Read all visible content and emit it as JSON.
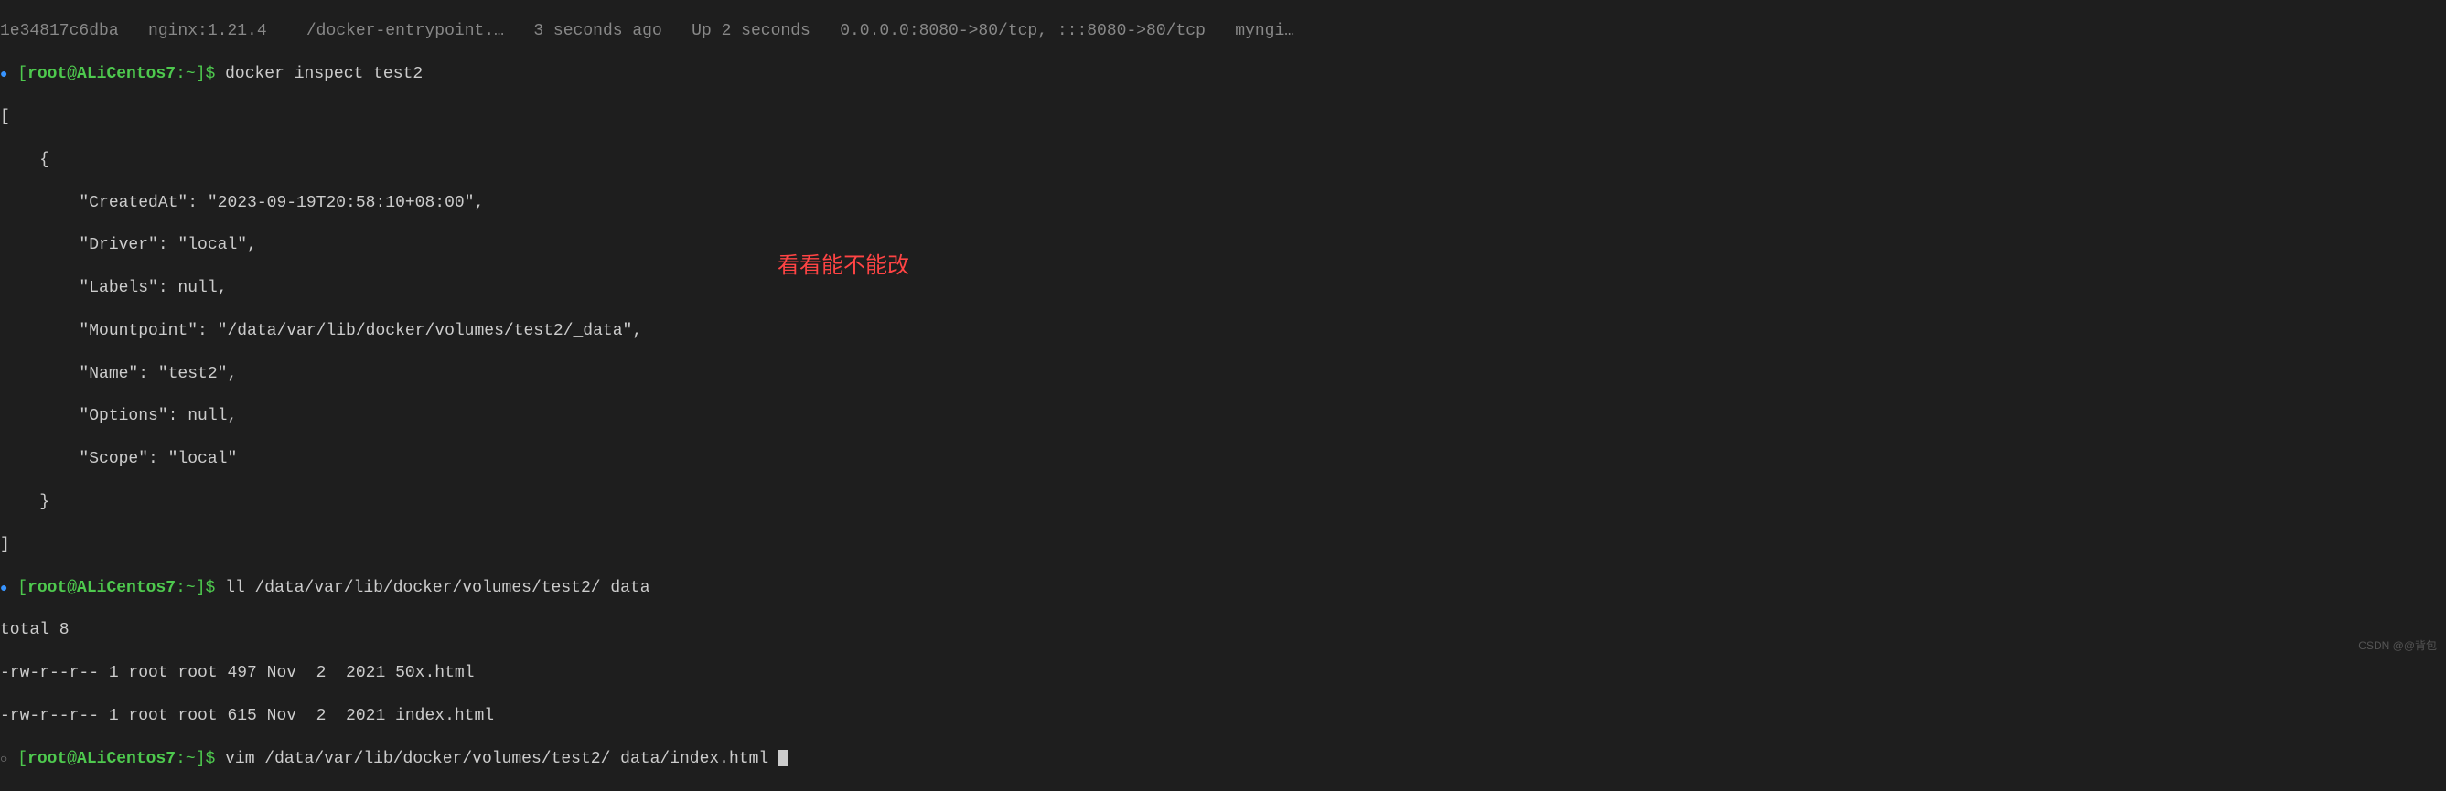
{
  "header": {
    "container_id": "1e34817c6dba",
    "image": "nginx:1.21.4",
    "command": "/docker-entrypoint.…",
    "created": "3 seconds ago",
    "status": "Up 2 seconds",
    "ports": "0.0.0.0:8080->80/tcp, :::8080->80/tcp",
    "names": "myngi…"
  },
  "prompt1": {
    "bracket_open": "[",
    "user": "root@ALiCentos7",
    "sep": ":",
    "path": "~",
    "bracket_close": "]$",
    "command": " docker inspect test2"
  },
  "inspect_output": {
    "open_bracket": "[",
    "open_brace": "    {",
    "created_at": "        \"CreatedAt\": \"2023-09-19T20:58:10+08:00\",",
    "driver": "        \"Driver\": \"local\",",
    "labels": "        \"Labels\": null,",
    "mountpoint": "        \"Mountpoint\": \"/data/var/lib/docker/volumes/test2/_data\",",
    "name": "        \"Name\": \"test2\",",
    "options": "        \"Options\": null,",
    "scope": "        \"Scope\": \"local\"",
    "close_brace": "    }",
    "close_bracket": "]"
  },
  "prompt2": {
    "bracket_open": "[",
    "user": "root@ALiCentos7",
    "sep": ":",
    "path": "~",
    "bracket_close": "]$",
    "command": " ll /data/var/lib/docker/volumes/test2/_data"
  },
  "ll_output": {
    "total": "total 8",
    "file1": "-rw-r--r-- 1 root root 497 Nov  2  2021 50x.html",
    "file2": "-rw-r--r-- 1 root root 615 Nov  2  2021 index.html"
  },
  "prompt3": {
    "bracket_open": "[",
    "user": "root@ALiCentos7",
    "sep": ":",
    "path": "~",
    "bracket_close": "]$",
    "command": " vim /data/var/lib/docker/volumes/test2/_data/index.html "
  },
  "annotation_text": "看看能不能改",
  "watermark_text": "CSDN @@背包"
}
